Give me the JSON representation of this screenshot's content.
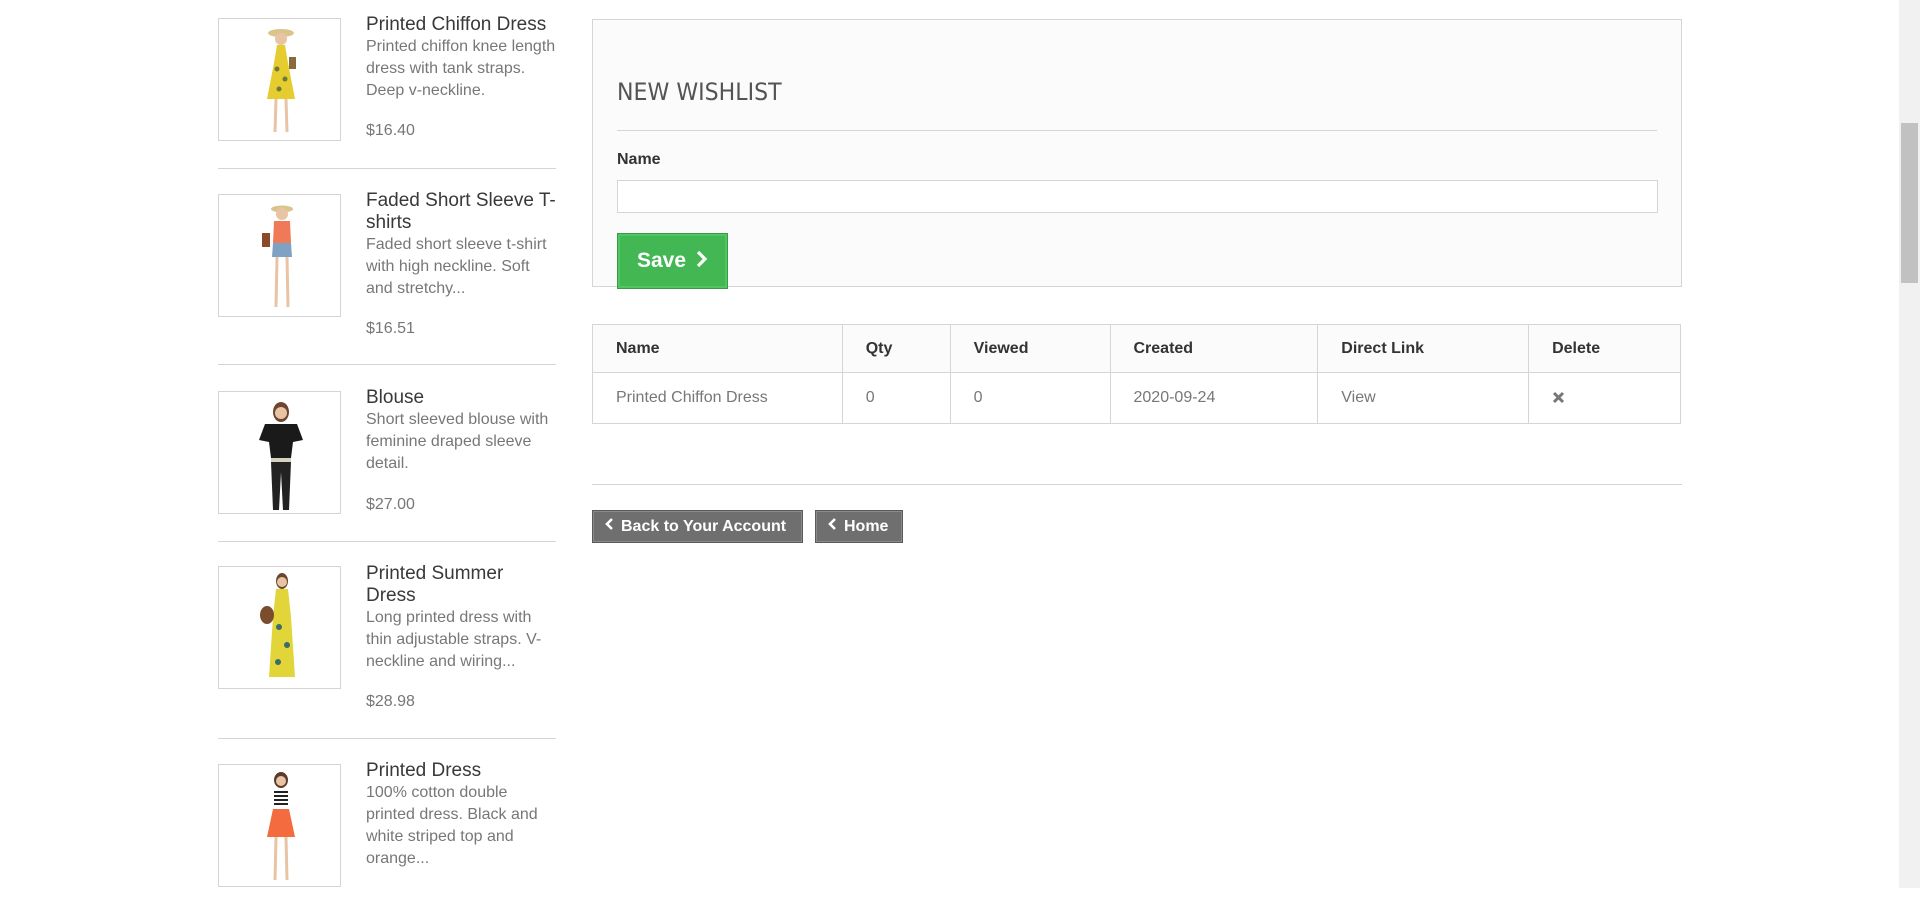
{
  "sidebar": {
    "products": [
      {
        "name": "Printed Chiffon Dress",
        "description": "Printed chiffon knee length dress with tank straps. Deep v-neckline.",
        "price": "$16.40",
        "image_icon": "yellow-dress-model-image",
        "dress_color": "#e5cc2f"
      },
      {
        "name": "Faded Short Sleeve T-shirts",
        "description": "Faded short sleeve t-shirt with high neckline. Soft and stretchy...",
        "price": "$16.51",
        "image_icon": "orange-tshirt-model-image",
        "dress_color": "#f07a57"
      },
      {
        "name": "Blouse",
        "description": "Short sleeved blouse with feminine draped sleeve detail.",
        "price": "$27.00",
        "image_icon": "black-blouse-model-image",
        "dress_color": "#1a1a1a"
      },
      {
        "name": "Printed Summer Dress",
        "description": "Long printed dress with thin adjustable straps. V-neckline and wiring...",
        "price": "$28.98",
        "image_icon": "yellow-summer-dress-model-image",
        "dress_color": "#e2d53a"
      },
      {
        "name": "Printed Dress",
        "description": "100% cotton double printed dress. Black and white striped top and orange...",
        "price": "",
        "image_icon": "orange-printed-dress-model-image",
        "dress_color": "#f46b3f"
      }
    ]
  },
  "wishlist_form": {
    "title": "NEW WISHLIST",
    "name_label": "Name",
    "name_value": "",
    "save_label": "Save",
    "save_icon": "chevron-right-icon"
  },
  "wishlist_table": {
    "headers": [
      "Name",
      "Qty",
      "Viewed",
      "Created",
      "Direct Link",
      "Delete"
    ],
    "rows": [
      {
        "name": "Printed Chiffon Dress",
        "qty": "0",
        "viewed": "0",
        "created": "2020-09-24",
        "link": "View",
        "delete_icon": "close-icon"
      }
    ]
  },
  "footer_nav": {
    "back_label": "Back to Your Account",
    "home_label": "Home",
    "chevron_icon": "chevron-left-icon"
  },
  "colors": {
    "save_button": "#43b754",
    "nav_button": "#6f6f6f",
    "border": "#d6d4d4"
  }
}
